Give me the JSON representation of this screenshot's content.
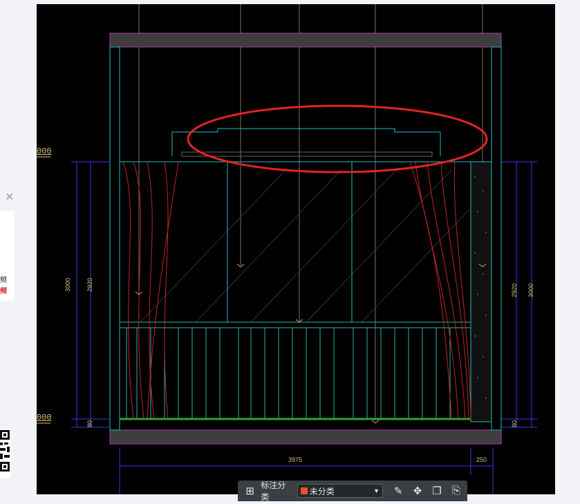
{
  "side_panel": {
    "close_icon": "close-icon",
    "qr_icon": "qr-code-icon",
    "text_1": "频",
    "text_2": "频"
  },
  "drawing": {
    "level_labels": [
      "000",
      "000"
    ],
    "dimensions": {
      "height_outer": "3000",
      "height_inner": "2920",
      "bottom_small": "80",
      "width_main": "3975",
      "width_side": "250",
      "right_height_inner": "2920",
      "right_height_outer": "3000",
      "right_small": "80"
    },
    "colors": {
      "background": "#000000",
      "frame": "#1fbfbf",
      "beam": "#3d3d3d",
      "magenta": "#b03ab0",
      "curtain": "#c0262b",
      "highlight": "#e32424",
      "dimension": "#3a3ae6",
      "dim_text": "#d9c27a",
      "railing": "#2ab3a8",
      "ground": "#2fa33a"
    }
  },
  "toolbar": {
    "grid_icon": "grid-icon",
    "label": "标注分类",
    "select_value": "未分类",
    "select_color": "#e8541c",
    "tools": [
      "edit-icon",
      "move-icon",
      "copy-icon",
      "paste-icon"
    ]
  }
}
